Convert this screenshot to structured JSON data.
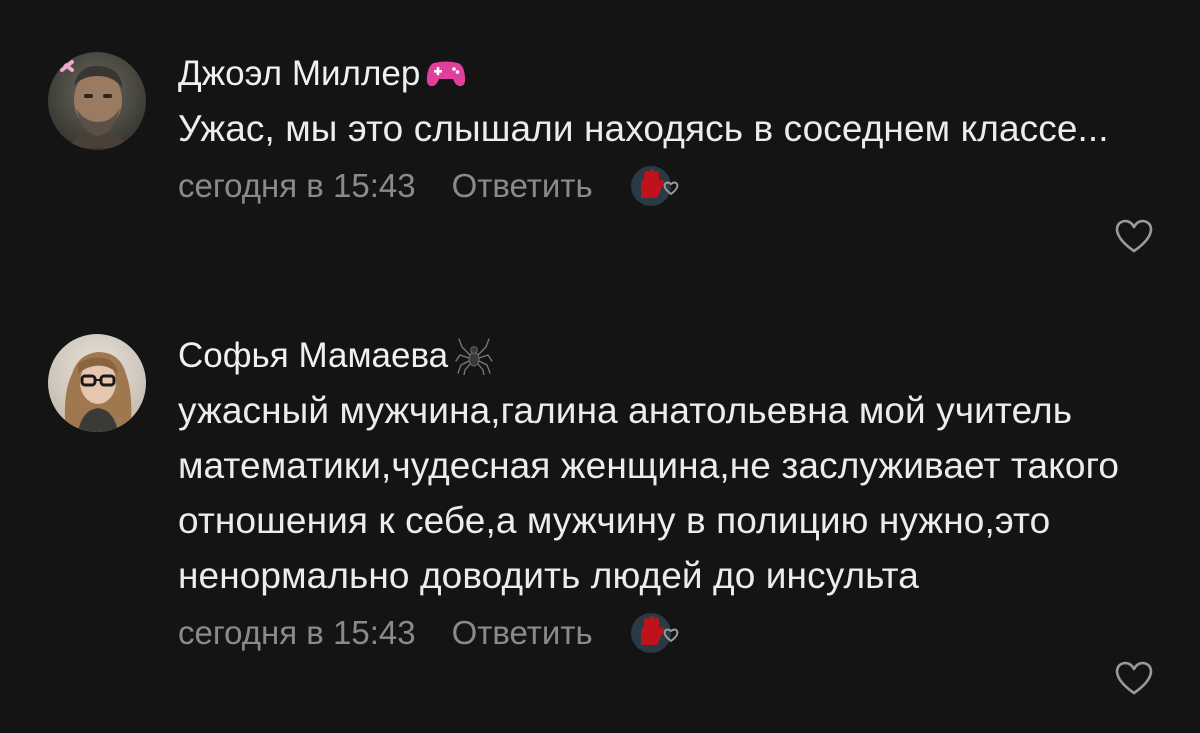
{
  "comments": [
    {
      "author": "Джоэл Миллер",
      "author_badge_icon": "gamepad-icon",
      "author_badge_color": "#e0409c",
      "text": "Ужас, мы это слышали находясь в соседнем классе...",
      "timestamp": "сегодня в 15:43",
      "reply_label": "Ответить",
      "reaction_icon": "red-hand-heart-icon",
      "like_icon": "heart-outline-icon"
    },
    {
      "author": "Софья Мамаева",
      "author_badge_icon": "spider-icon",
      "text": "ужасный мужчина,галина анатольевна мой учитель математики,чудесная женщина,не заслуживает такого отношения к себе,а мужчину в полицию нужно,это ненормально доводить людей до инсульта",
      "timestamp": "сегодня в 15:43",
      "reply_label": "Ответить",
      "reaction_icon": "red-hand-heart-icon",
      "like_icon": "heart-outline-icon"
    }
  ],
  "colors": {
    "background": "#141414",
    "text": "#ebebeb",
    "meta": "#8a8a8a",
    "reaction_hand": "#c0121c"
  }
}
